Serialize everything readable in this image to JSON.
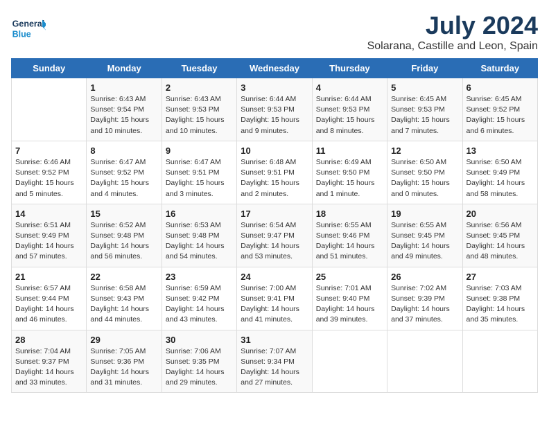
{
  "logo": {
    "line1": "General",
    "line2": "Blue"
  },
  "title": "July 2024",
  "subtitle": "Solarana, Castille and Leon, Spain",
  "days_of_week": [
    "Sunday",
    "Monday",
    "Tuesday",
    "Wednesday",
    "Thursday",
    "Friday",
    "Saturday"
  ],
  "weeks": [
    [
      {
        "day": "",
        "content": ""
      },
      {
        "day": "1",
        "content": "Sunrise: 6:43 AM\nSunset: 9:54 PM\nDaylight: 15 hours\nand 10 minutes."
      },
      {
        "day": "2",
        "content": "Sunrise: 6:43 AM\nSunset: 9:53 PM\nDaylight: 15 hours\nand 10 minutes."
      },
      {
        "day": "3",
        "content": "Sunrise: 6:44 AM\nSunset: 9:53 PM\nDaylight: 15 hours\nand 9 minutes."
      },
      {
        "day": "4",
        "content": "Sunrise: 6:44 AM\nSunset: 9:53 PM\nDaylight: 15 hours\nand 8 minutes."
      },
      {
        "day": "5",
        "content": "Sunrise: 6:45 AM\nSunset: 9:53 PM\nDaylight: 15 hours\nand 7 minutes."
      },
      {
        "day": "6",
        "content": "Sunrise: 6:45 AM\nSunset: 9:52 PM\nDaylight: 15 hours\nand 6 minutes."
      }
    ],
    [
      {
        "day": "7",
        "content": "Sunrise: 6:46 AM\nSunset: 9:52 PM\nDaylight: 15 hours\nand 5 minutes."
      },
      {
        "day": "8",
        "content": "Sunrise: 6:47 AM\nSunset: 9:52 PM\nDaylight: 15 hours\nand 4 minutes."
      },
      {
        "day": "9",
        "content": "Sunrise: 6:47 AM\nSunset: 9:51 PM\nDaylight: 15 hours\nand 3 minutes."
      },
      {
        "day": "10",
        "content": "Sunrise: 6:48 AM\nSunset: 9:51 PM\nDaylight: 15 hours\nand 2 minutes."
      },
      {
        "day": "11",
        "content": "Sunrise: 6:49 AM\nSunset: 9:50 PM\nDaylight: 15 hours\nand 1 minute."
      },
      {
        "day": "12",
        "content": "Sunrise: 6:50 AM\nSunset: 9:50 PM\nDaylight: 15 hours\nand 0 minutes."
      },
      {
        "day": "13",
        "content": "Sunrise: 6:50 AM\nSunset: 9:49 PM\nDaylight: 14 hours\nand 58 minutes."
      }
    ],
    [
      {
        "day": "14",
        "content": "Sunrise: 6:51 AM\nSunset: 9:49 PM\nDaylight: 14 hours\nand 57 minutes."
      },
      {
        "day": "15",
        "content": "Sunrise: 6:52 AM\nSunset: 9:48 PM\nDaylight: 14 hours\nand 56 minutes."
      },
      {
        "day": "16",
        "content": "Sunrise: 6:53 AM\nSunset: 9:48 PM\nDaylight: 14 hours\nand 54 minutes."
      },
      {
        "day": "17",
        "content": "Sunrise: 6:54 AM\nSunset: 9:47 PM\nDaylight: 14 hours\nand 53 minutes."
      },
      {
        "day": "18",
        "content": "Sunrise: 6:55 AM\nSunset: 9:46 PM\nDaylight: 14 hours\nand 51 minutes."
      },
      {
        "day": "19",
        "content": "Sunrise: 6:55 AM\nSunset: 9:45 PM\nDaylight: 14 hours\nand 49 minutes."
      },
      {
        "day": "20",
        "content": "Sunrise: 6:56 AM\nSunset: 9:45 PM\nDaylight: 14 hours\nand 48 minutes."
      }
    ],
    [
      {
        "day": "21",
        "content": "Sunrise: 6:57 AM\nSunset: 9:44 PM\nDaylight: 14 hours\nand 46 minutes."
      },
      {
        "day": "22",
        "content": "Sunrise: 6:58 AM\nSunset: 9:43 PM\nDaylight: 14 hours\nand 44 minutes."
      },
      {
        "day": "23",
        "content": "Sunrise: 6:59 AM\nSunset: 9:42 PM\nDaylight: 14 hours\nand 43 minutes."
      },
      {
        "day": "24",
        "content": "Sunrise: 7:00 AM\nSunset: 9:41 PM\nDaylight: 14 hours\nand 41 minutes."
      },
      {
        "day": "25",
        "content": "Sunrise: 7:01 AM\nSunset: 9:40 PM\nDaylight: 14 hours\nand 39 minutes."
      },
      {
        "day": "26",
        "content": "Sunrise: 7:02 AM\nSunset: 9:39 PM\nDaylight: 14 hours\nand 37 minutes."
      },
      {
        "day": "27",
        "content": "Sunrise: 7:03 AM\nSunset: 9:38 PM\nDaylight: 14 hours\nand 35 minutes."
      }
    ],
    [
      {
        "day": "28",
        "content": "Sunrise: 7:04 AM\nSunset: 9:37 PM\nDaylight: 14 hours\nand 33 minutes."
      },
      {
        "day": "29",
        "content": "Sunrise: 7:05 AM\nSunset: 9:36 PM\nDaylight: 14 hours\nand 31 minutes."
      },
      {
        "day": "30",
        "content": "Sunrise: 7:06 AM\nSunset: 9:35 PM\nDaylight: 14 hours\nand 29 minutes."
      },
      {
        "day": "31",
        "content": "Sunrise: 7:07 AM\nSunset: 9:34 PM\nDaylight: 14 hours\nand 27 minutes."
      },
      {
        "day": "",
        "content": ""
      },
      {
        "day": "",
        "content": ""
      },
      {
        "day": "",
        "content": ""
      }
    ]
  ]
}
